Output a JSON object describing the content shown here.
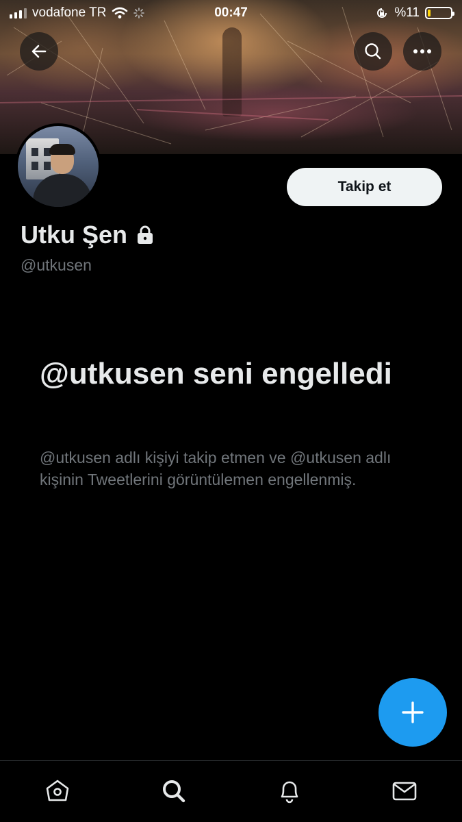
{
  "status_bar": {
    "carrier": "vodafone TR",
    "time": "00:47",
    "battery_text": "%11",
    "battery_level": 0.11,
    "colors": {
      "battery_fill": "#ffd60a"
    }
  },
  "header": {
    "back_icon": "arrow-left-icon",
    "search_icon": "search-icon",
    "more_icon": "more-dots-icon"
  },
  "profile": {
    "display_name": "Utku Şen",
    "handle": "@utkusen",
    "locked_icon": "lock-icon",
    "follow_label": "Takip et"
  },
  "blocked": {
    "title": "@utkusen seni engelledi",
    "description": "@utkusen adlı kişiyi takip etmen ve @utkusen adlı kişinin Tweetlerini görüntülemen engellenmiş."
  },
  "fab": {
    "icon": "plus-icon",
    "color": "#1d9bf0"
  },
  "bottom_nav": {
    "items": [
      {
        "name": "home",
        "icon": "home-icon"
      },
      {
        "name": "search",
        "icon": "search-icon"
      },
      {
        "name": "notifications",
        "icon": "bell-icon"
      },
      {
        "name": "messages",
        "icon": "mail-icon"
      }
    ]
  }
}
